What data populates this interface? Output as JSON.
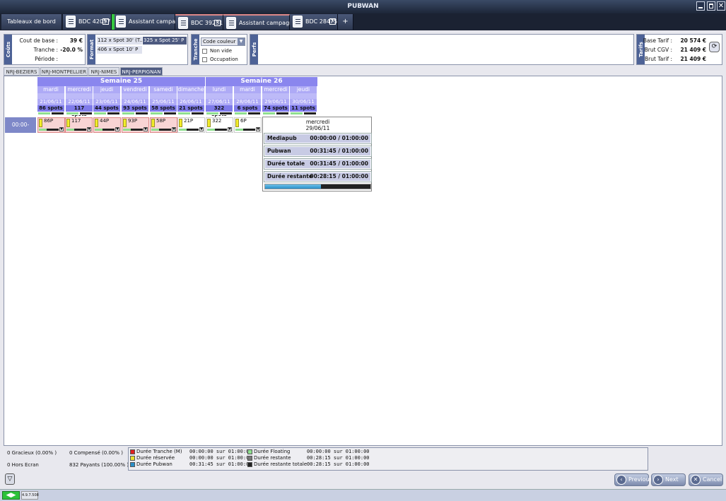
{
  "app": {
    "title": "PUBWAN"
  },
  "tabs": [
    {
      "label": "Tableaux de bord"
    },
    {
      "label": "BDC 42057"
    },
    {
      "label": "Assistant campagne"
    },
    {
      "label": "BDC 39231"
    },
    {
      "label": "Assistant campagne"
    },
    {
      "label": "BDC 28475"
    },
    {
      "label": "+"
    }
  ],
  "couts": {
    "section": "Coûts",
    "base_label": "Cout de base :",
    "base_value": "39 €",
    "tranche_label": "Tranche :",
    "tranche_value": "-20.0 %",
    "periode_label": "Période :",
    "periode_value": ""
  },
  "format": {
    "section": "Format",
    "items": [
      "112 x Spot 30' (T...",
      "325 x Spot 25' P",
      "406 x Spot 10' P"
    ]
  },
  "tranche": {
    "section": "Tranche",
    "select_value": "Code couleur",
    "opt1": "Non vide",
    "opt2": "Occupation"
  },
  "perfs": {
    "section": "Perfs"
  },
  "tarifs": {
    "section": "Tarifs",
    "base_label": "Base Tarif :",
    "base_value": "20 574 €",
    "cgv_label": "Brut CGV :",
    "cgv_value": "21 409 €",
    "brut_label": "Brut Tarif :",
    "brut_value": "21 409 €"
  },
  "channel_tabs": [
    "NRJ-BEZIERS",
    "NRJ-MONTPELLIER",
    "NRJ-NIMES",
    "NRJ-PERPIGNAN"
  ],
  "weeks": [
    "Semaine 25",
    "Semaine 26"
  ],
  "days": [
    {
      "name": "mardi",
      "date": "21/06/11",
      "spots": "86 spots"
    },
    {
      "name": "mercredi",
      "date": "22/06/11",
      "spots": "117 spots"
    },
    {
      "name": "jeudi",
      "date": "23/06/11",
      "spots": "44 spots"
    },
    {
      "name": "vendredi",
      "date": "24/06/11",
      "spots": "93 spots"
    },
    {
      "name": "samedi",
      "date": "25/06/11",
      "spots": "58 spots"
    },
    {
      "name": "dimanche",
      "date": "26/06/11",
      "spots": "21 spots"
    },
    {
      "name": "lundi",
      "date": "27/06/11",
      "spots": "322 spots"
    },
    {
      "name": "mardi",
      "date": "28/06/11",
      "spots": "6 spots"
    },
    {
      "name": "mercredi",
      "date": "29/06/11",
      "spots": "74 spots"
    },
    {
      "name": "jeudi",
      "date": "30/06/11",
      "spots": "11 spots"
    }
  ],
  "slot": {
    "label": "00:00-00:00",
    "cells": [
      "86P",
      "117",
      "44P",
      "93P",
      "58P",
      "21P",
      "322",
      "6P"
    ]
  },
  "popup": {
    "day": "mercredi",
    "date": "29/06/11",
    "rows": [
      {
        "label": "Mediapub",
        "value": "00:00:00 / 01:00:00"
      },
      {
        "label": "Pubwan",
        "value": "00:31:45 / 01:00:00"
      },
      {
        "label": "Durée totale",
        "value": "00:31:45 / 01:00:00"
      },
      {
        "label": "Durée restante",
        "value": "00:28:15 / 01:00:00"
      }
    ]
  },
  "stats": {
    "gracieux": "0 Gracieux (0.00% )",
    "compense": "0 Compensé (0.00% )",
    "hors_ecran": "0 Hors Ecran",
    "payants": "832 Payants (100.00% )"
  },
  "legend": [
    {
      "label": "Durée Tranche (M)",
      "value": "00:00:00 sur 01:00:00",
      "color": "#e02020"
    },
    {
      "label": "Durée réservée",
      "value": "00:00:00 sur 01:00:00",
      "color": "#e8e030"
    },
    {
      "label": "Durée Pubwan",
      "value": "00:31:45 sur 01:00:00",
      "color": "#2a8fc8"
    },
    {
      "label": "Durée Floating",
      "value": "00:00:00 sur 01:00:00",
      "color": "#8fdf8f"
    },
    {
      "label": "Durée restante",
      "value": "00:28:15 sur 01:00:00",
      "color": "#777777"
    },
    {
      "label": "Durée restante totale",
      "value": "00:28:15 sur 01:00:00",
      "color": "#222222"
    }
  ],
  "nav": {
    "previous": "Previous",
    "next": "Next",
    "cancel": "Cancel"
  },
  "version": "4.9.7.508",
  "popup_progress": 0.53
}
